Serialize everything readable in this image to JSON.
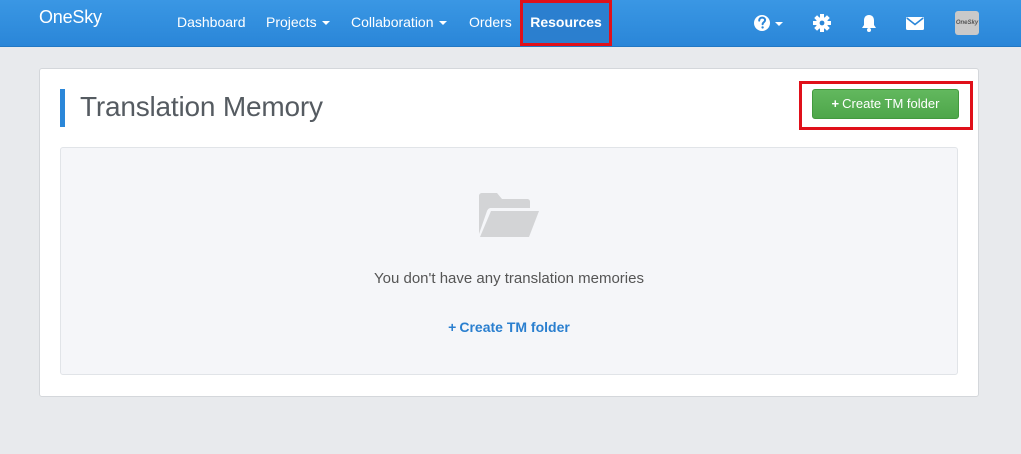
{
  "navbar": {
    "brand": "OneSky",
    "items": [
      {
        "label": "Dashboard"
      },
      {
        "label": "Projects"
      },
      {
        "label": "Collaboration"
      },
      {
        "label": "Orders"
      },
      {
        "label": "Resources"
      }
    ],
    "icons": [
      "help-icon",
      "gear-icon",
      "bell-icon",
      "mail-icon"
    ],
    "avatar_text": "OneSky"
  },
  "main": {
    "title": "Translation Memory",
    "create_button_label": "Create TM folder",
    "plus_glyph": "+",
    "empty_state": {
      "icon": "folder-open-icon",
      "message": "You don't have any translation memories",
      "link_label": "Create TM folder"
    }
  },
  "colors": {
    "navbar": "#2a86d8",
    "accent": "#2b87d9",
    "success_button": "#5cb85c",
    "highlight": "#e0101a"
  }
}
